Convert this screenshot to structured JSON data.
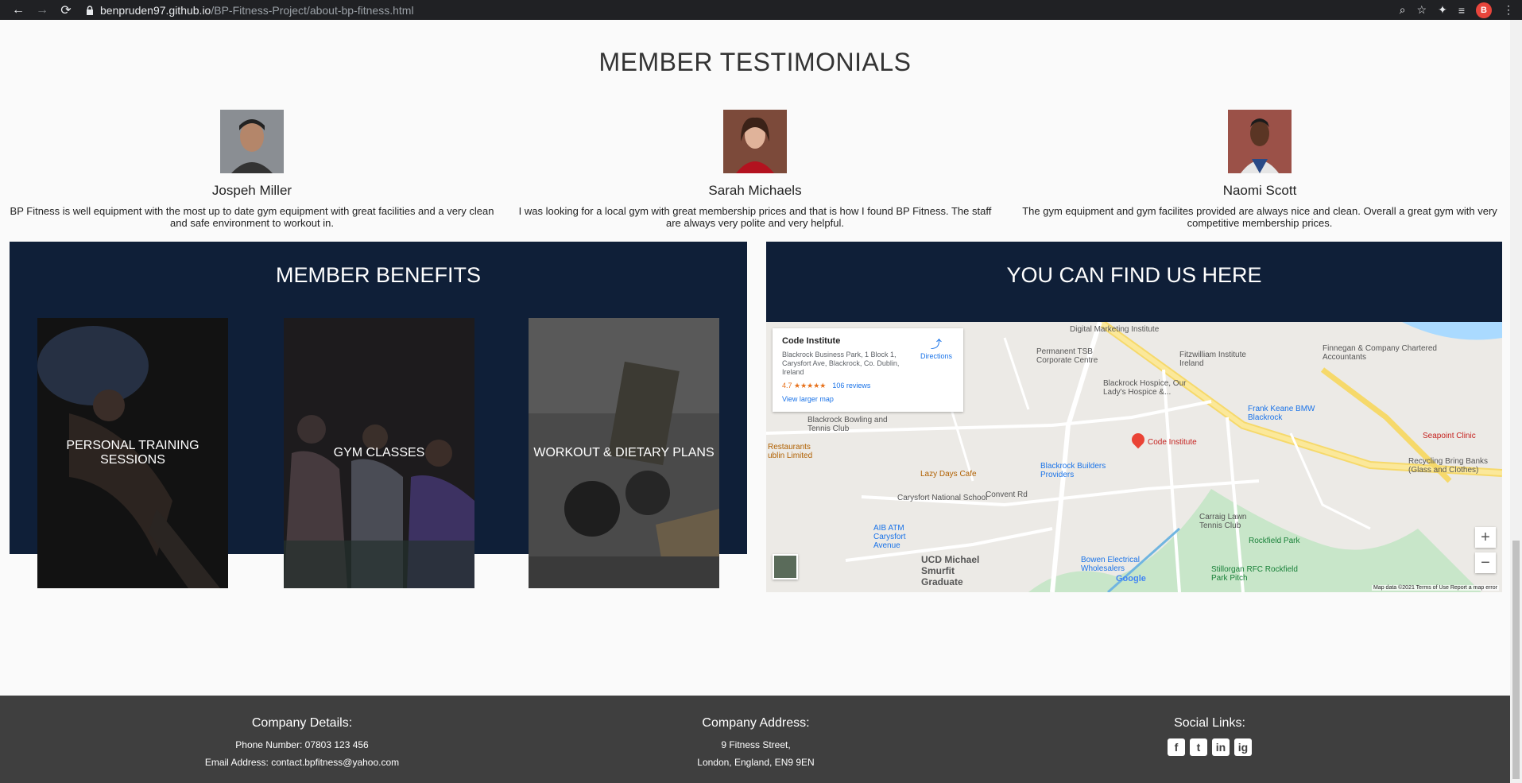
{
  "browser": {
    "url_host": "benpruden97.github.io",
    "url_path": "/BP-Fitness-Project/about-bp-fitness.html",
    "profile_initial": "B"
  },
  "testimonials": {
    "title": "MEMBER TESTIMONIALS",
    "items": [
      {
        "name": "Jospeh Miller",
        "quote": "BP Fitness is well equipment with the most up to date gym equipment with great facilities and a very clean and safe environment to workout in."
      },
      {
        "name": "Sarah Michaels",
        "quote": "I was looking for a local gym with great membership prices and that is how I found BP Fitness. The staff are always very polite and very helpful."
      },
      {
        "name": "Naomi Scott",
        "quote": "The gym equipment and gym facilites provided are always nice and clean. Overall a great gym with very competitive membership prices."
      }
    ]
  },
  "benefits": {
    "title": "MEMBER BENEFITS",
    "items": [
      {
        "label": "PERSONAL TRAINING SESSIONS"
      },
      {
        "label": "GYM CLASSES"
      },
      {
        "label": "WORKOUT & DIETARY PLANS"
      }
    ]
  },
  "find_us": {
    "title": "YOU CAN FIND US HERE",
    "map": {
      "place_name": "Code Institute",
      "address": "Blackrock Business Park, 1 Block 1, Carysfort Ave, Blackrock, Co. Dublin, Ireland",
      "rating": "4.7 ★★★★★",
      "reviews": "106 reviews",
      "larger_map": "View larger map",
      "directions": "Directions",
      "pin_label": "Code Institute",
      "labels": [
        "Digital Marketing Institute",
        "Permanent TSB Corporate Centre",
        "Fitzwilliam Institute Ireland",
        "Finnegan & Company Chartered Accountants",
        "Blackrock Hospice, Our Lady's Hospice &...",
        "Frank Keane BMW Blackrock",
        "Blackrock Bowling and Tennis Club",
        "Seapoint Clinic",
        "Recycling Bring Banks (Glass and Clothes)",
        "Blackrock Builders Providers",
        "Lazy Days Cafe",
        "Carysfort National School",
        "Convent Rd",
        "Carraig Lawn Tennis Club",
        "AIB ATM Carysfort Avenue",
        "Rockfield Park",
        "UCD Michael Smurfit Graduate",
        "Bowen Electrical Wholesalers",
        "Stillorgan RFC Rockfield Park Pitch",
        "Restaurants ublin Limited"
      ],
      "zoom_in": "+",
      "zoom_out": "−",
      "footer": "Map data ©2021   Terms of Use   Report a map error",
      "google": "Google"
    }
  },
  "footer": {
    "details_title": "Company Details:",
    "phone": "Phone Number: 07803 123 456",
    "email": "Email Address: contact.bpfitness@yahoo.com",
    "address_title": "Company Address:",
    "address_line1": "9 Fitness Street,",
    "address_line2": "London, England, EN9 9EN",
    "social_title": "Social Links:",
    "social": [
      "f",
      "t",
      "in",
      "ig"
    ]
  }
}
